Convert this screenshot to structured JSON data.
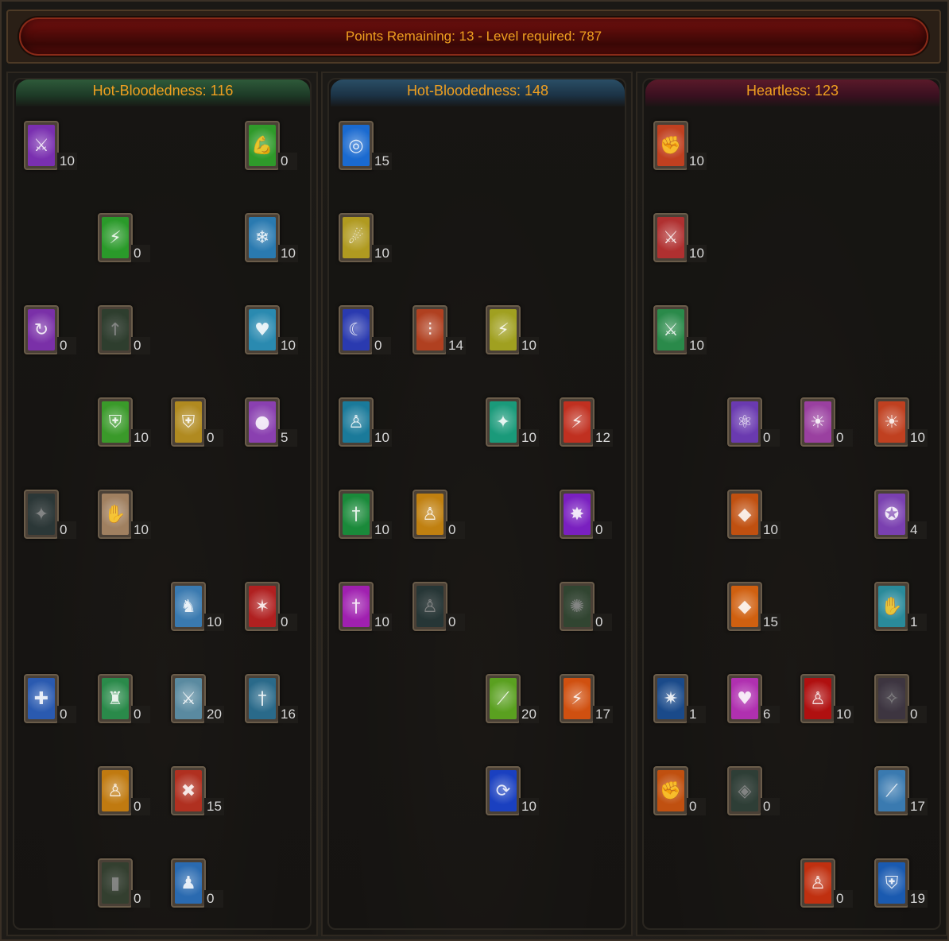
{
  "header": {
    "text": "Points Remaining: 13 - Level required: 787"
  },
  "trees": [
    {
      "title": "Hot-Bloodedness: 116",
      "skills": [
        {
          "r": 0,
          "c": 0,
          "points": "10",
          "icon": "crossbow-icon",
          "bg": "#7a2fb0",
          "glyph": "⚔"
        },
        {
          "r": 0,
          "c": 3,
          "points": "0",
          "icon": "flex-arm-icon",
          "bg": "#2f9a2a",
          "glyph": "💪"
        },
        {
          "r": 1,
          "c": 1,
          "points": "0",
          "icon": "lightning-bolt-icon",
          "bg": "#2a9a2a",
          "glyph": "⚡"
        },
        {
          "r": 1,
          "c": 3,
          "points": "10",
          "icon": "ice-sword-icon",
          "bg": "#2a7ab0",
          "glyph": "❄"
        },
        {
          "r": 2,
          "c": 0,
          "points": "0",
          "icon": "refresh-gem-icon",
          "bg": "#7a30a8",
          "glyph": "↻"
        },
        {
          "r": 2,
          "c": 1,
          "points": "0",
          "icon": "arrow-up-icon",
          "bg": "#3a7a3a",
          "glyph": "↑",
          "dim": true
        },
        {
          "r": 2,
          "c": 3,
          "points": "10",
          "icon": "heart-shield-icon",
          "bg": "#2a8ab0",
          "glyph": "♥"
        },
        {
          "r": 3,
          "c": 1,
          "points": "10",
          "icon": "shield-icon",
          "bg": "#3a9a2a",
          "glyph": "⛨"
        },
        {
          "r": 3,
          "c": 2,
          "points": "0",
          "icon": "golden-shield-icon",
          "bg": "#b08a20",
          "glyph": "⛨"
        },
        {
          "r": 3,
          "c": 3,
          "points": "5",
          "icon": "purple-orb-icon",
          "bg": "#8a40b0",
          "glyph": "●"
        },
        {
          "r": 4,
          "c": 0,
          "points": "0",
          "icon": "teal-sigil-icon",
          "bg": "#3a6a6a",
          "glyph": "✦",
          "dim": true
        },
        {
          "r": 4,
          "c": 1,
          "points": "10",
          "icon": "claw-icon",
          "bg": "#a08060",
          "glyph": "✋"
        },
        {
          "r": 5,
          "c": 2,
          "points": "10",
          "icon": "warrior-icon",
          "bg": "#3a7ab0",
          "glyph": "♞"
        },
        {
          "r": 5,
          "c": 3,
          "points": "0",
          "icon": "red-slash-icon",
          "bg": "#b02020",
          "glyph": "✶"
        },
        {
          "r": 6,
          "c": 0,
          "points": "0",
          "icon": "purple-cross-icon",
          "bg": "#2a5ab0",
          "glyph": "✚"
        },
        {
          "r": 6,
          "c": 1,
          "points": "0",
          "icon": "red-knight-icon",
          "bg": "#2a8a4a",
          "glyph": "♜"
        },
        {
          "r": 6,
          "c": 2,
          "points": "20",
          "icon": "blade-icon",
          "bg": "#5a8aa0",
          "glyph": "⚔"
        },
        {
          "r": 6,
          "c": 3,
          "points": "16",
          "icon": "raised-sword-icon",
          "bg": "#2a6a8a",
          "glyph": "†"
        },
        {
          "r": 7,
          "c": 1,
          "points": "0",
          "icon": "golden-figure-icon",
          "bg": "#c07a10",
          "glyph": "♙"
        },
        {
          "r": 7,
          "c": 2,
          "points": "15",
          "icon": "crossed-swords-icon",
          "bg": "#b03020",
          "glyph": "✖"
        },
        {
          "r": 8,
          "c": 1,
          "points": "0",
          "icon": "green-totem-icon",
          "bg": "#4a7a3a",
          "glyph": "▮",
          "dim": true
        },
        {
          "r": 8,
          "c": 2,
          "points": "0",
          "icon": "blue-figure-icon",
          "bg": "#2a6ab0",
          "glyph": "♟"
        }
      ]
    },
    {
      "title": "Hot-Bloodedness: 148",
      "skills": [
        {
          "r": 0,
          "c": 0,
          "points": "15",
          "icon": "target-icon",
          "bg": "#1a6ad0",
          "glyph": "◎"
        },
        {
          "r": 1,
          "c": 0,
          "points": "10",
          "icon": "flame-hand-icon",
          "bg": "#b09a20",
          "glyph": "☄"
        },
        {
          "r": 2,
          "c": 0,
          "points": "0",
          "icon": "blue-crescent-icon",
          "bg": "#2a3ab0",
          "glyph": "☾"
        },
        {
          "r": 2,
          "c": 1,
          "points": "14",
          "icon": "claws-icon",
          "bg": "#b04020",
          "glyph": "⫶"
        },
        {
          "r": 2,
          "c": 2,
          "points": "10",
          "icon": "yellow-bolt-icon",
          "bg": "#a0a020",
          "glyph": "⚡"
        },
        {
          "r": 3,
          "c": 0,
          "points": "10",
          "icon": "blue-figure-icon",
          "bg": "#1a7a9a",
          "glyph": "♙"
        },
        {
          "r": 3,
          "c": 2,
          "points": "10",
          "icon": "teal-blade-icon",
          "bg": "#1a9a7a",
          "glyph": "✦"
        },
        {
          "r": 3,
          "c": 3,
          "points": "12",
          "icon": "red-lightning-icon",
          "bg": "#c03020",
          "glyph": "⚡"
        },
        {
          "r": 4,
          "c": 0,
          "points": "10",
          "icon": "green-sword-icon",
          "bg": "#1a8a3a",
          "glyph": "†"
        },
        {
          "r": 4,
          "c": 1,
          "points": "0",
          "icon": "fire-figure-icon",
          "bg": "#c08010",
          "glyph": "♙"
        },
        {
          "r": 4,
          "c": 3,
          "points": "0",
          "icon": "purple-burst-icon",
          "bg": "#7a20c0",
          "glyph": "✸"
        },
        {
          "r": 5,
          "c": 0,
          "points": "10",
          "icon": "magenta-blade-icon",
          "bg": "#a020b0",
          "glyph": "†"
        },
        {
          "r": 5,
          "c": 1,
          "points": "0",
          "icon": "teal-figure-icon",
          "bg": "#2a6a6a",
          "glyph": "♙",
          "dim": true
        },
        {
          "r": 5,
          "c": 3,
          "points": "0",
          "icon": "green-swirl-icon",
          "bg": "#3a8a3a",
          "glyph": "✺",
          "dim": true
        },
        {
          "r": 6,
          "c": 2,
          "points": "20",
          "icon": "green-slash-icon",
          "bg": "#5aa020",
          "glyph": "⟋"
        },
        {
          "r": 6,
          "c": 3,
          "points": "17",
          "icon": "orange-bolt-icon",
          "bg": "#d05010",
          "glyph": "⚡"
        },
        {
          "r": 7,
          "c": 2,
          "points": "10",
          "icon": "blue-vortex-icon",
          "bg": "#1a40c0",
          "glyph": "⟳"
        }
      ]
    },
    {
      "title": "Heartless: 123",
      "skills": [
        {
          "r": 0,
          "c": 0,
          "points": "10",
          "icon": "fist-icon",
          "bg": "#c04020",
          "glyph": "✊"
        },
        {
          "r": 1,
          "c": 0,
          "points": "10",
          "icon": "flaming-sword-icon",
          "bg": "#b03030",
          "glyph": "⚔"
        },
        {
          "r": 2,
          "c": 0,
          "points": "10",
          "icon": "green-sword-icon",
          "bg": "#2a8a4a",
          "glyph": "⚔"
        },
        {
          "r": 3,
          "c": 1,
          "points": "0",
          "icon": "atom-icon",
          "bg": "#6a3ab0",
          "glyph": "⚛"
        },
        {
          "r": 3,
          "c": 2,
          "points": "0",
          "icon": "golden-orb-hands-icon",
          "bg": "#9a40a0",
          "glyph": "☀"
        },
        {
          "r": 3,
          "c": 3,
          "points": "10",
          "icon": "fire-orb-hands-icon",
          "bg": "#c04020",
          "glyph": "☀"
        },
        {
          "r": 4,
          "c": 1,
          "points": "10",
          "icon": "flame-crystal-icon",
          "bg": "#c05010",
          "glyph": "◆"
        },
        {
          "r": 4,
          "c": 3,
          "points": "4",
          "icon": "blue-orb-hands-icon",
          "bg": "#7a40b0",
          "glyph": "✪"
        },
        {
          "r": 5,
          "c": 1,
          "points": "15",
          "icon": "fire-crystal-icon",
          "bg": "#d06010",
          "glyph": "◆"
        },
        {
          "r": 5,
          "c": 3,
          "points": "1",
          "icon": "healing-hands-icon",
          "bg": "#2a8a9a",
          "glyph": "✋"
        },
        {
          "r": 6,
          "c": 0,
          "points": "1",
          "icon": "blue-spark-icon",
          "bg": "#1a4a8a",
          "glyph": "✷"
        },
        {
          "r": 6,
          "c": 1,
          "points": "6",
          "icon": "pink-heart-icon",
          "bg": "#b030b0",
          "glyph": "♥"
        },
        {
          "r": 6,
          "c": 2,
          "points": "10",
          "icon": "raised-arms-icon",
          "bg": "#b01010",
          "glyph": "♙"
        },
        {
          "r": 6,
          "c": 3,
          "points": "0",
          "icon": "faded-rune-icon",
          "bg": "#7a5a8a",
          "glyph": "✧",
          "dim": true
        },
        {
          "r": 7,
          "c": 0,
          "points": "0",
          "icon": "fire-fist-icon",
          "bg": "#c05010",
          "glyph": "✊"
        },
        {
          "r": 7,
          "c": 1,
          "points": "0",
          "icon": "green-rune-icon",
          "bg": "#3a7a5a",
          "glyph": "◈",
          "dim": true
        },
        {
          "r": 7,
          "c": 3,
          "points": "17",
          "icon": "sword-swipe-icon",
          "bg": "#3a7ab0",
          "glyph": "⟋"
        },
        {
          "r": 8,
          "c": 2,
          "points": "0",
          "icon": "fire-figure-icon",
          "bg": "#c03010",
          "glyph": "♙"
        },
        {
          "r": 8,
          "c": 3,
          "points": "19",
          "icon": "blue-shield-icon",
          "bg": "#1a5ab0",
          "glyph": "⛨"
        }
      ]
    }
  ]
}
